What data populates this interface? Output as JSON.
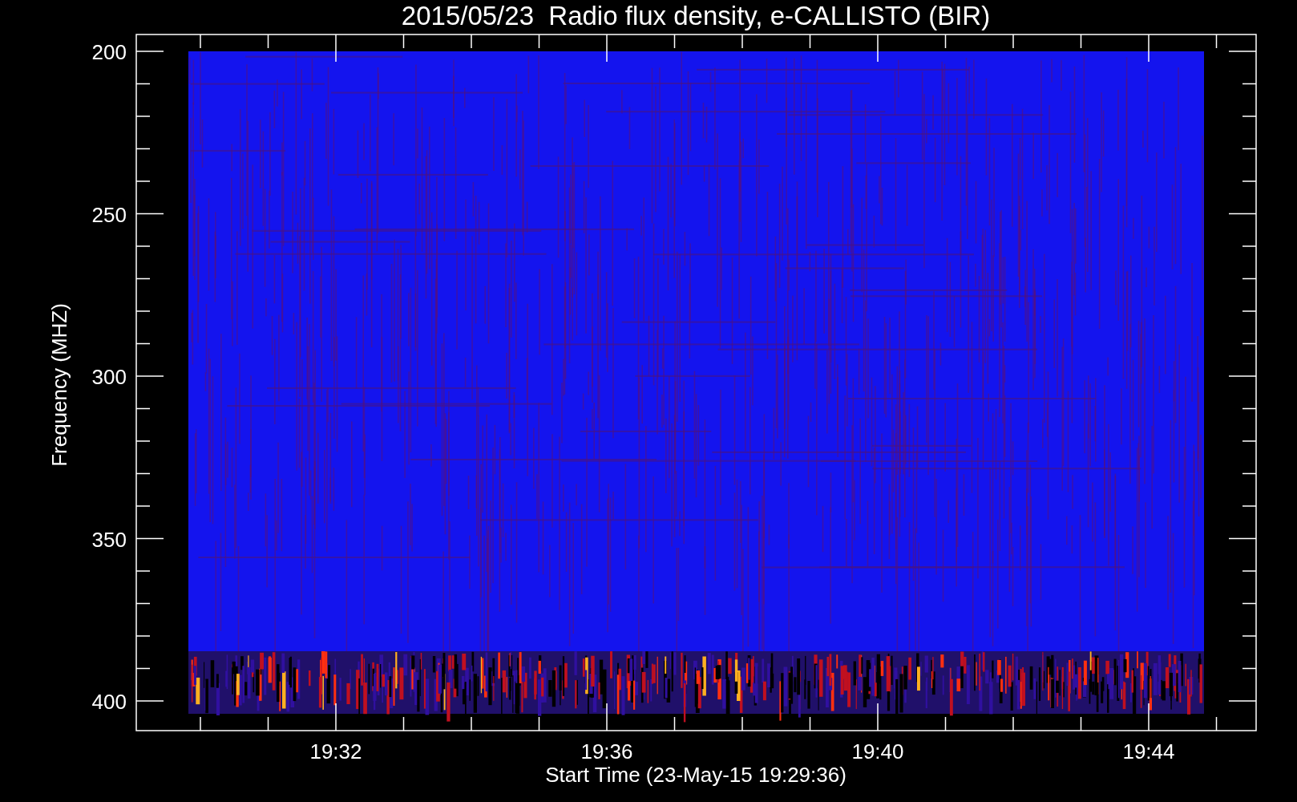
{
  "title": "2015/05/23  Radio flux density, e-CALLISTO (BIR)",
  "y_axis": {
    "label": "Frequency (MHZ)",
    "ticks": [
      "200",
      "250",
      "300",
      "350",
      "400"
    ]
  },
  "x_axis": {
    "label": "Start Time (23-May-15 19:29:36)",
    "ticks": [
      "19:32",
      "19:36",
      "19:40",
      "19:44"
    ]
  }
}
